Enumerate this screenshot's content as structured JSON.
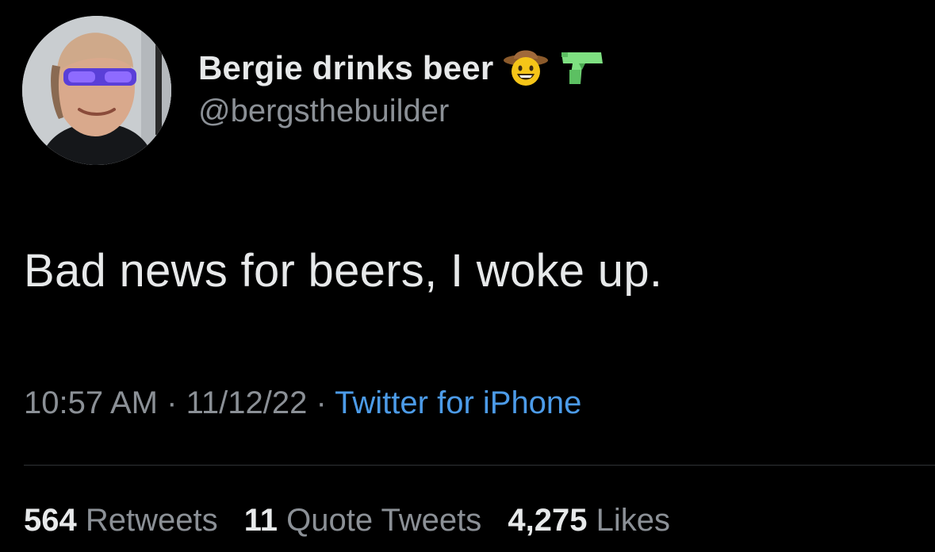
{
  "tweet": {
    "author": {
      "display_name": "Bergie drinks beer",
      "handle": "@bergsthebuilder",
      "name_emojis": [
        "cowboy-hat-face-icon",
        "water-pistol-icon"
      ]
    },
    "text": "Bad news for beers, I woke up.",
    "meta": {
      "time": "10:57 AM",
      "separator": "·",
      "date": "11/12/22",
      "source": "Twitter for iPhone"
    },
    "stats": {
      "retweets_count": "564",
      "retweets_label": "Retweets",
      "quote_tweets_count": "11",
      "quote_tweets_label": "Quote Tweets",
      "likes_count": "4,275",
      "likes_label": "Likes"
    }
  },
  "colors": {
    "background": "#000000",
    "primary_text": "#e7e9ea",
    "secondary_text": "#8b9096",
    "link": "#4c9be8",
    "divider": "#2f3336"
  }
}
